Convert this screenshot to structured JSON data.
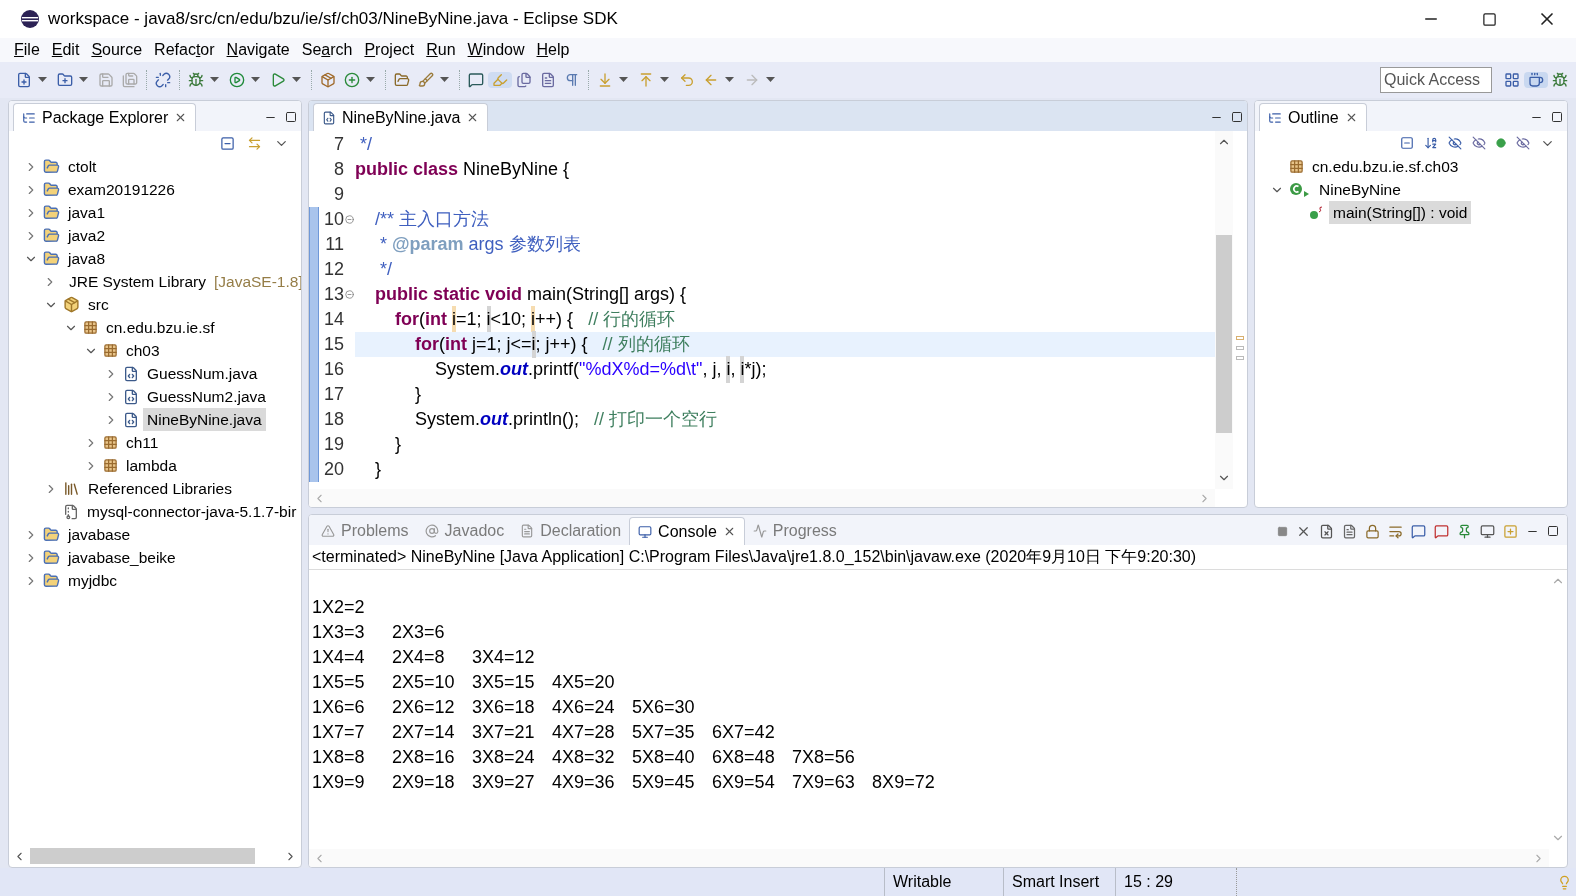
{
  "window": {
    "title": "workspace - java8/src/cn/edu/bzu/ie/sf/ch03/NineByNine.java - Eclipse SDK"
  },
  "menu": [
    {
      "key": "F",
      "after": "ile"
    },
    {
      "key": "E",
      "after": "dit"
    },
    {
      "key": "S",
      "after": "ource"
    },
    {
      "before": "Refac",
      "key": "t",
      "after": "or"
    },
    {
      "key": "N",
      "after": "avigate"
    },
    {
      "before": "Se",
      "key": "a",
      "after": "rch"
    },
    {
      "key": "P",
      "after": "roject"
    },
    {
      "key": "R",
      "after": "un"
    },
    {
      "key": "W",
      "after": "indow"
    },
    {
      "key": "H",
      "after": "elp"
    }
  ],
  "quick_access": {
    "placeholder": "Quick Access"
  },
  "package_explorer": {
    "tabs": [
      {
        "label": "Package Explorer",
        "selected": true
      }
    ],
    "tree": [
      {
        "label": "ctolt",
        "kind": "project",
        "expanded": false,
        "selected": false
      },
      {
        "label": "exam20191226",
        "kind": "project",
        "expanded": false,
        "selected": false
      },
      {
        "label": "java1",
        "kind": "project",
        "expanded": false,
        "selected": false
      },
      {
        "label": "java2",
        "kind": "project",
        "expanded": false,
        "selected": false
      },
      {
        "label": "java8",
        "kind": "project",
        "expanded": true,
        "selected": false,
        "children": [
          {
            "label": "JRE System Library",
            "decoration": "[JavaSE-1.8]",
            "kind": "library",
            "expanded": false,
            "selected": false
          },
          {
            "label": "src",
            "kind": "source_folder",
            "expanded": true,
            "selected": false,
            "children": [
              {
                "label": "cn.edu.bzu.ie.sf",
                "kind": "package",
                "expanded": true,
                "selected": false,
                "children": [
                  {
                    "label": "ch03",
                    "kind": "package",
                    "expanded": true,
                    "selected": false,
                    "children": [
                      {
                        "label": "GuessNum.java",
                        "kind": "java_file",
                        "expanded": false,
                        "selected": false
                      },
                      {
                        "label": "GuessNum2.java",
                        "kind": "java_file",
                        "expanded": false,
                        "selected": false
                      },
                      {
                        "label": "NineByNine.java",
                        "kind": "java_file",
                        "expanded": false,
                        "selected": true
                      }
                    ]
                  },
                  {
                    "label": "ch11",
                    "kind": "package",
                    "expanded": false,
                    "selected": false
                  },
                  {
                    "label": "lambda",
                    "kind": "package",
                    "expanded": false,
                    "selected": false
                  }
                ]
              }
            ]
          },
          {
            "label": "Referenced Libraries",
            "kind": "library",
            "expanded": false,
            "selected": false
          },
          {
            "label": "mysql-connector-java-5.1.7-bir",
            "kind": "jar",
            "selected": false
          }
        ]
      },
      {
        "label": "javabase",
        "kind": "project",
        "expanded": false,
        "selected": false
      },
      {
        "label": "javabase_beike",
        "kind": "project",
        "expanded": false,
        "selected": false
      },
      {
        "label": "myjdbc",
        "kind": "project",
        "expanded": false,
        "selected": false
      }
    ]
  },
  "editor": {
    "tabs": [
      {
        "label": "NineByNine.java",
        "selected": true
      }
    ],
    "lines": [
      {
        "number": "7",
        "current": false,
        "changed": false,
        "foldable": false,
        "tokens": [
          {
            "text": " */",
            "kind": "javadoc"
          }
        ]
      },
      {
        "number": "8",
        "current": false,
        "changed": false,
        "foldable": false,
        "tokens": [
          {
            "text": "public class",
            "kind": "keyword"
          },
          {
            "text": " NineByNine {",
            "kind": "plain"
          }
        ]
      },
      {
        "number": "9",
        "current": false,
        "changed": false,
        "foldable": false
      },
      {
        "number": "10",
        "current": false,
        "changed": true,
        "foldable": true,
        "tokens": [
          {
            "text": "    /** 主入口方法",
            "kind": "javadoc"
          }
        ]
      },
      {
        "number": "11",
        "current": false,
        "changed": true,
        "foldable": false,
        "tokens": [
          {
            "text": "     * ",
            "kind": "javadoc"
          },
          {
            "text": "@param",
            "kind": "doc_tag"
          },
          {
            "text": " args 参数列表",
            "kind": "javadoc"
          }
        ]
      },
      {
        "number": "12",
        "current": false,
        "changed": true,
        "foldable": false,
        "tokens": [
          {
            "text": "     */",
            "kind": "javadoc"
          }
        ]
      },
      {
        "number": "13",
        "current": false,
        "changed": true,
        "foldable": true,
        "tokens": [
          {
            "text": "    public static void",
            "kind": "keyword"
          },
          {
            "text": " main(String[] args) {",
            "kind": "plain"
          }
        ]
      },
      {
        "number": "14",
        "current": false,
        "changed": true,
        "foldable": false,
        "tokens": [
          {
            "text": "        for",
            "kind": "keyword"
          },
          {
            "text": "(",
            "kind": "plain"
          },
          {
            "text": "int ",
            "kind": "keyword"
          },
          {
            "text": "i",
            "kind": "write_occurrence"
          },
          {
            "text": "=1; ",
            "kind": "plain"
          },
          {
            "text": "i",
            "kind": "read_occurrence"
          },
          {
            "text": "<10; ",
            "kind": "plain"
          },
          {
            "text": "i",
            "kind": "write_occurrence"
          },
          {
            "text": "++) {   ",
            "kind": "plain"
          },
          {
            "text": "// 行的循环",
            "kind": "comment"
          }
        ]
      },
      {
        "number": "15",
        "current": true,
        "changed": true,
        "foldable": false,
        "tokens": [
          {
            "text": "            for",
            "kind": "keyword"
          },
          {
            "text": "(",
            "kind": "plain"
          },
          {
            "text": "int",
            "kind": "keyword"
          },
          {
            "text": " j=1; j<=",
            "kind": "plain"
          },
          {
            "text": "i",
            "kind": "read_occurrence"
          },
          {
            "text": "; j++) {   ",
            "kind": "plain"
          },
          {
            "text": "// 列的循环",
            "kind": "comment"
          }
        ]
      },
      {
        "number": "16",
        "current": false,
        "changed": true,
        "foldable": false,
        "tokens": [
          {
            "text": "                System.",
            "kind": "plain"
          },
          {
            "text": "out",
            "kind": "field"
          },
          {
            "text": ".printf(",
            "kind": "plain"
          },
          {
            "text": "\"%dX%d=%d\\t\"",
            "kind": "string"
          },
          {
            "text": ", j, ",
            "kind": "plain"
          },
          {
            "text": "i",
            "kind": "read_occurrence"
          },
          {
            "text": ", ",
            "kind": "plain"
          },
          {
            "text": "i",
            "kind": "read_occurrence"
          },
          {
            "text": "*j);",
            "kind": "plain"
          }
        ]
      },
      {
        "number": "17",
        "current": false,
        "changed": true,
        "foldable": false,
        "tokens": [
          {
            "text": "            }",
            "kind": "plain"
          }
        ]
      },
      {
        "number": "18",
        "current": false,
        "changed": true,
        "foldable": false,
        "tokens": [
          {
            "text": "            System.",
            "kind": "plain"
          },
          {
            "text": "out",
            "kind": "field"
          },
          {
            "text": ".println();   ",
            "kind": "plain"
          },
          {
            "text": "// 打印一个空行",
            "kind": "comment"
          }
        ]
      },
      {
        "number": "19",
        "current": false,
        "changed": true,
        "foldable": false,
        "tokens": [
          {
            "text": "        }",
            "kind": "plain"
          }
        ]
      },
      {
        "number": "20",
        "current": false,
        "changed": true,
        "foldable": false,
        "tokens": [
          {
            "text": "    }",
            "kind": "plain"
          }
        ]
      }
    ]
  },
  "outline": {
    "tabs": [
      {
        "label": "Outline",
        "selected": true
      }
    ],
    "tree": [
      {
        "label": "cn.edu.bzu.ie.sf.ch03",
        "kind": "package",
        "selected": false
      },
      {
        "label": "NineByNine",
        "kind": "class",
        "expanded": true,
        "selected": false,
        "children": [
          {
            "label": "main(String[]) : void",
            "kind": "method",
            "selected": true
          }
        ]
      }
    ]
  },
  "console": {
    "tabs": [
      {
        "label": "Problems",
        "selected": false
      },
      {
        "label": "Javadoc",
        "selected": false
      },
      {
        "label": "Declaration",
        "selected": false
      },
      {
        "label": "Console",
        "selected": true
      },
      {
        "label": "Progress",
        "selected": false
      }
    ],
    "process": "<terminated> NineByNine [Java Application] C:\\Program Files\\Java\\jre1.8.0_152\\bin\\javaw.exe (2020年9月10日 下午9:20:30)",
    "output": [
      "1X2=2",
      "1X3=3\t2X3=6",
      "1X4=4\t2X4=8\t3X4=12",
      "1X5=5\t2X5=10\t3X5=15\t4X5=20",
      "1X6=6\t2X6=12\t3X6=18\t4X6=24\t5X6=30",
      "1X7=7\t2X7=14\t3X7=21\t4X7=28\t5X7=35\t6X7=42",
      "1X8=8\t2X8=16\t3X8=24\t4X8=32\t5X8=40\t6X8=48\t7X8=56",
      "1X9=9\t2X9=18\t3X9=27\t4X9=36\t5X9=45\t6X9=54\t7X9=63\t8X9=72"
    ]
  },
  "status_bar": [
    "Writable",
    "Smart Insert",
    "15 : 29"
  ]
}
